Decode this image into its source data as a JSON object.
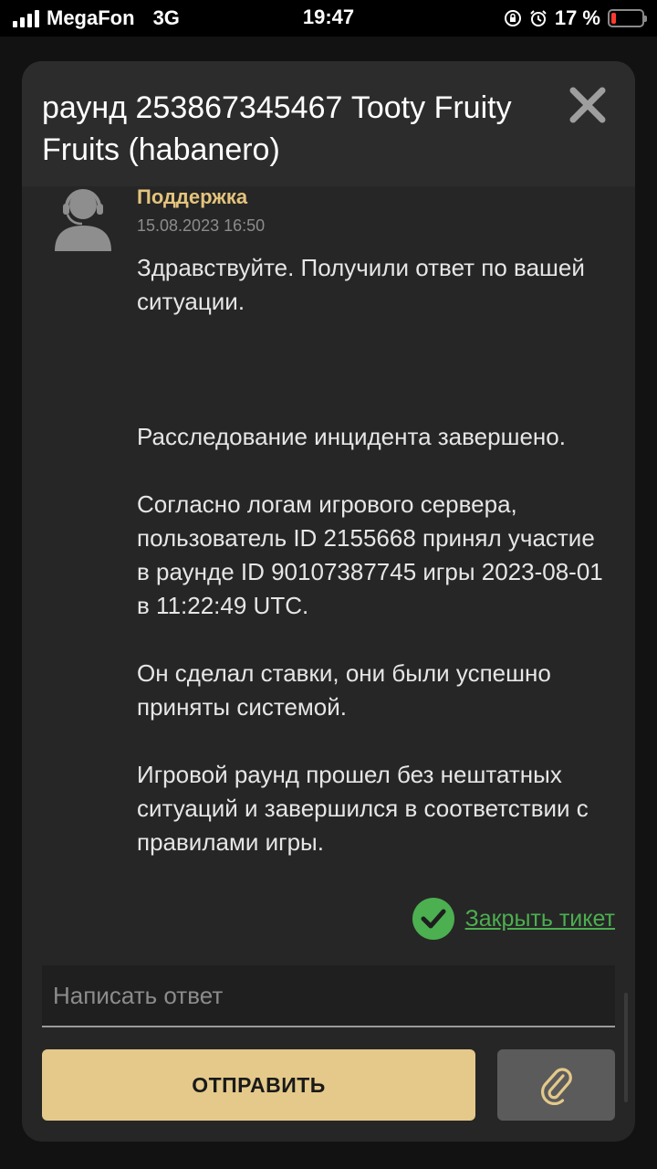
{
  "status_bar": {
    "carrier": "MegaFon",
    "network": "3G",
    "time": "19:47",
    "battery_percent": "17 %",
    "battery_level": 0.17,
    "battery_color": "#ff3b30",
    "icons": [
      "signal-icon",
      "orientation-lock-icon",
      "alarm-icon",
      "battery-icon"
    ]
  },
  "ticket": {
    "title": "раунд 253867345467 Tooty Fruity Fruits (habanero)",
    "close_icon": "close-icon"
  },
  "message": {
    "author": "Поддержка",
    "date": "15.08.2023 16:50",
    "avatar_icon": "support-agent-icon",
    "paragraphs": [
      "Здравствуйте. Получили ответ по вашей ситуации.",
      "Расследование инцидента завершено.",
      "Согласно логам игрового сервера, пользователь ID 2155668 принял участие в раунде ID 90107387745 игры 2023-08-01 в 11:22:49 UTC.",
      "Он сделал ставки, они были успешно приняты системой.",
      "Игровой раунд прошел без нештатных ситуаций и завершился в соответствии с правилами игры."
    ]
  },
  "actions": {
    "close_ticket_label": "Закрыть тикет",
    "close_ticket_icon": "check-circle-icon",
    "reply_placeholder": "Написать ответ",
    "reply_value": "",
    "send_label": "ОТПРАВИТЬ",
    "attach_icon": "paperclip-icon"
  },
  "colors": {
    "accent_gold": "#e4c98a",
    "author_gold": "#e4c47c",
    "success_green": "#4caf50",
    "attach_gray": "#5b5b5b",
    "modal_bg": "#262626"
  }
}
